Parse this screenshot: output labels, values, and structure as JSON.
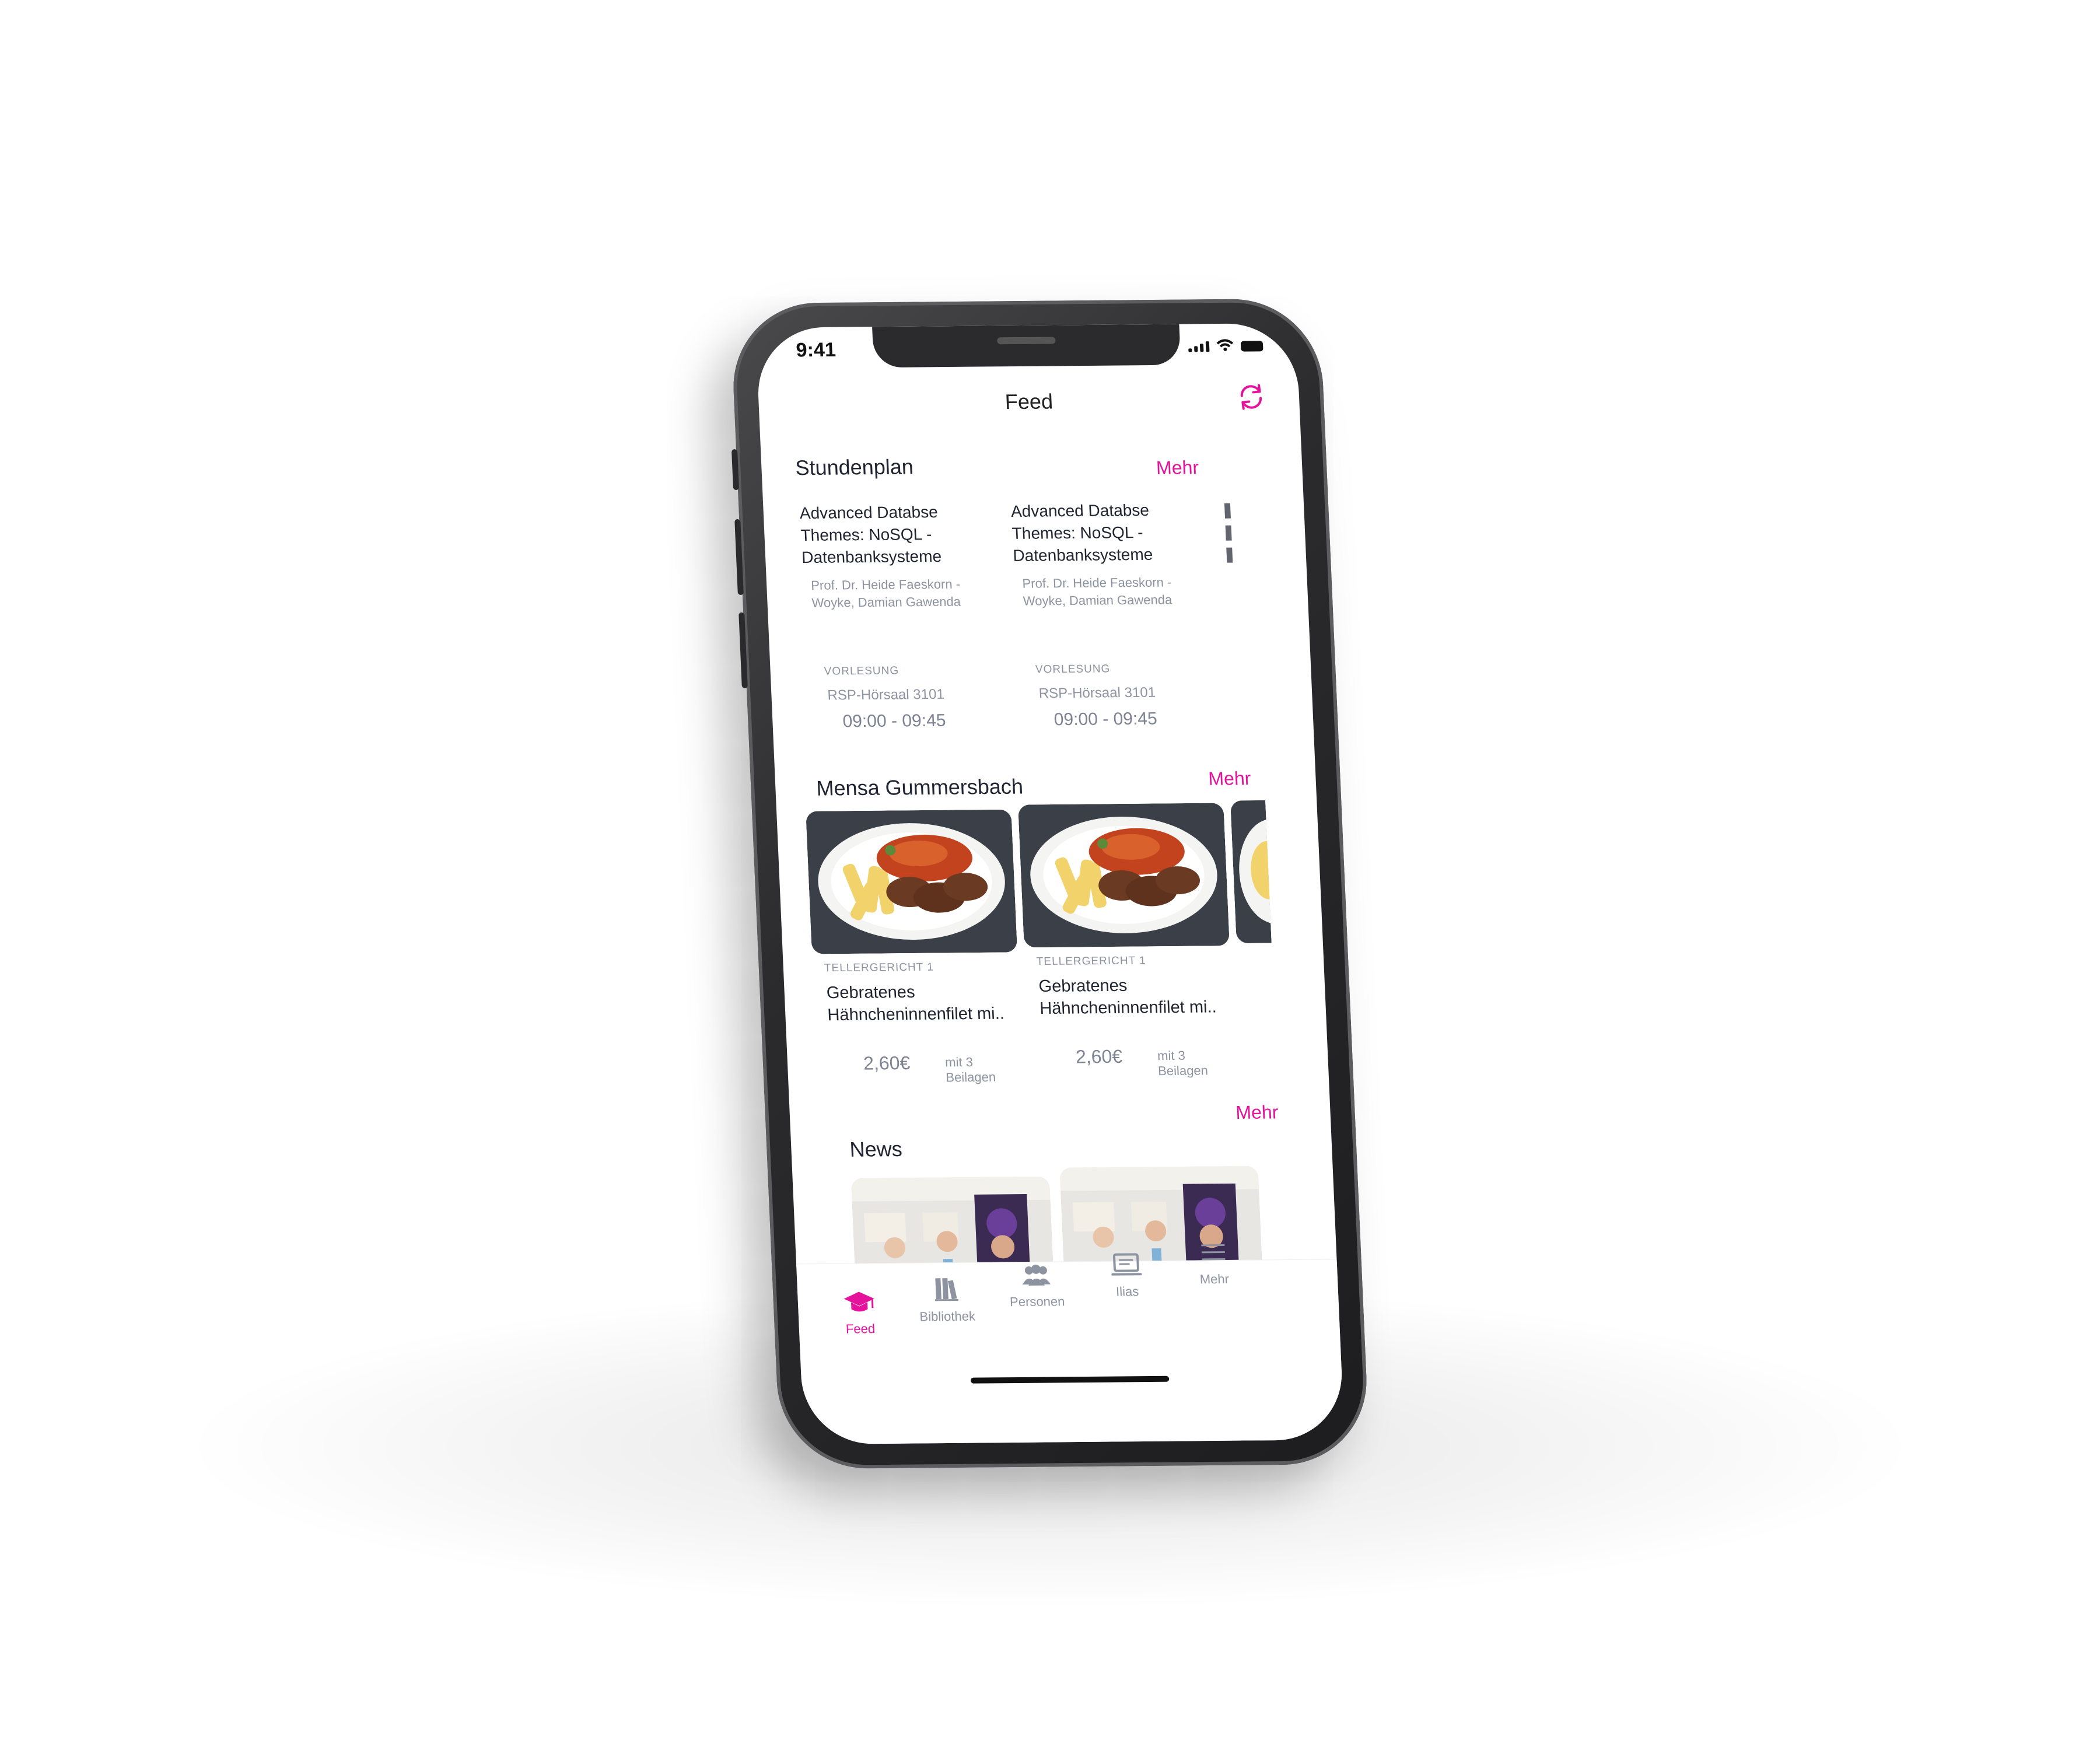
{
  "status_bar": {
    "time": "9:41"
  },
  "header": {
    "title": "Feed"
  },
  "accent_color": "#e5129b",
  "schedule": {
    "title": "Stundenplan",
    "more_label": "Mehr",
    "items": [
      {
        "title": "Advanced Databse Themes: NoSQL - Datenbanksysteme",
        "lecturer": "Prof. Dr. Heide Faeskorn - Woyke, Damian Gawenda",
        "type": "VORLESUNG",
        "room": "RSP-Hörsaal 3101",
        "time": "09:00 - 09:45"
      },
      {
        "title": "Advanced Databse Themes: NoSQL - Datenbanksysteme",
        "lecturer": "Prof. Dr. Heide Faeskorn - Woyke, Damian Gawenda",
        "type": "VORLESUNG",
        "room": "RSP-Hörsaal 3101",
        "time": "09:00 - 09:45"
      }
    ]
  },
  "mensa": {
    "title": "Mensa Gummersbach",
    "more_label": "Mehr",
    "items": [
      {
        "category": "TELLERGERICHT 1",
        "name": "Gebratenes Hähncheninnenfilet mi..",
        "price": "2,60€",
        "note": "mit 3 Beilagen"
      },
      {
        "category": "TELLERGERICHT 1",
        "name": "Gebratenes Hähncheninnenfilet mi..",
        "price": "2,60€",
        "note": "mit 3 Beilagen"
      }
    ]
  },
  "news": {
    "title": "News",
    "more_label": "Mehr"
  },
  "tabbar": {
    "items": [
      {
        "label": "Feed",
        "icon": "graduation-cap-icon",
        "active": true
      },
      {
        "label": "Bibliothek",
        "icon": "books-icon",
        "active": false
      },
      {
        "label": "Personen",
        "icon": "people-icon",
        "active": false
      },
      {
        "label": "Ilias",
        "icon": "laptop-icon",
        "active": false
      },
      {
        "label": "Mehr",
        "icon": "menu-icon",
        "active": false
      }
    ]
  }
}
